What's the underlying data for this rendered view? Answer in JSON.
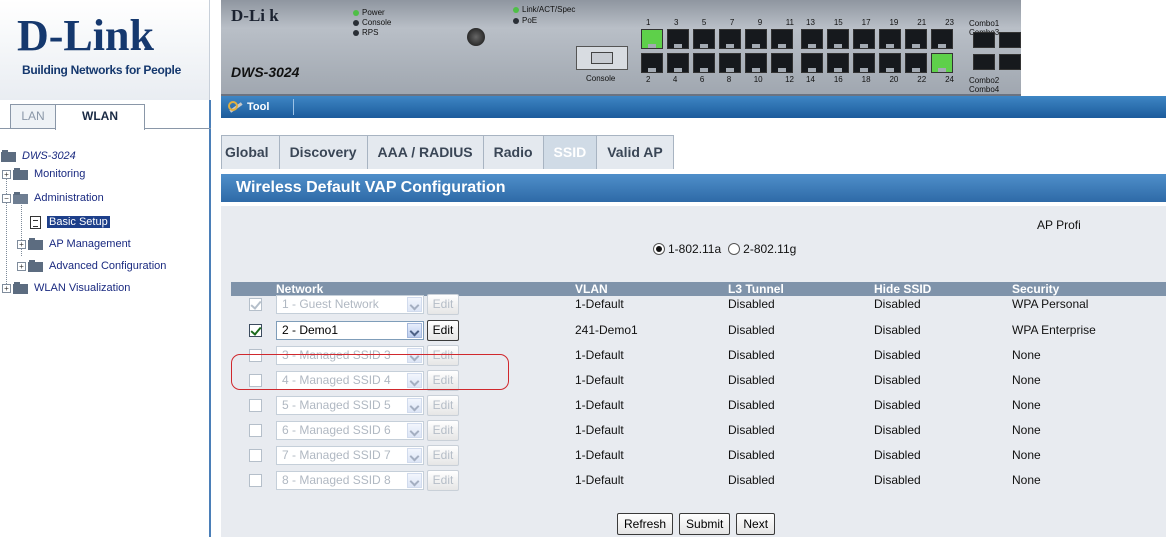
{
  "logo": {
    "brand": "D-Link",
    "tagline": "Building Networks for People"
  },
  "device": {
    "brand": "D-Li k",
    "model": "DWS-3024",
    "leds": [
      "Power",
      "Console",
      "RPS",
      "Link/ACT/Spec",
      "PoE"
    ],
    "console_label": "Console",
    "port_numbers_top": [
      "1",
      "3",
      "5",
      "7",
      "9",
      "11",
      "13",
      "15",
      "17",
      "19",
      "21",
      "23"
    ],
    "port_numbers_bottom": [
      "2",
      "4",
      "6",
      "8",
      "10",
      "12",
      "14",
      "16",
      "18",
      "20",
      "22",
      "24"
    ],
    "combo_top": "Combo1 Combo3",
    "combo_bottom": "Combo2 Combo4"
  },
  "toolbar": {
    "tool_label": "Tool"
  },
  "sidebar": {
    "tabs": [
      {
        "label": "LAN"
      },
      {
        "label": "WLAN"
      }
    ],
    "tree": [
      {
        "label": "DWS-3024"
      },
      {
        "label": "Monitoring"
      },
      {
        "label": "Administration"
      },
      {
        "label": "Basic Setup"
      },
      {
        "label": "AP Management"
      },
      {
        "label": "Advanced Configuration"
      },
      {
        "label": "WLAN Visualization"
      }
    ]
  },
  "main": {
    "tabs": [
      {
        "label": "Global"
      },
      {
        "label": "Discovery"
      },
      {
        "label": "AAA / RADIUS"
      },
      {
        "label": "Radio"
      },
      {
        "label": "SSID"
      },
      {
        "label": "Valid AP"
      }
    ],
    "active_tab": "SSID",
    "panel_title": "Wireless Default VAP Configuration",
    "ap_profile_label": "AP Profi",
    "radio_options": [
      {
        "label": "1-802.11a",
        "selected": true
      },
      {
        "label": "2-802.11g",
        "selected": false
      }
    ],
    "table": {
      "headers": {
        "network": "Network",
        "vlan": "VLAN",
        "l3_tunnel": "L3 Tunnel",
        "hide_ssid": "Hide SSID",
        "security": "Security"
      },
      "rows": [
        {
          "checked": true,
          "enabled": false,
          "network": "1 - Guest Network",
          "edit": "Edit",
          "vlan": "1-Default",
          "l3_tunnel": "Disabled",
          "hide_ssid": "Disabled",
          "security": "WPA Personal"
        },
        {
          "checked": true,
          "enabled": true,
          "network": "2 - Demo1",
          "edit": "Edit",
          "vlan": "241-Demo1",
          "l3_tunnel": "Disabled",
          "hide_ssid": "Disabled",
          "security": "WPA Enterprise"
        },
        {
          "checked": false,
          "enabled": false,
          "network": "3 - Managed SSID 3",
          "edit": "Edit",
          "vlan": "1-Default",
          "l3_tunnel": "Disabled",
          "hide_ssid": "Disabled",
          "security": "None"
        },
        {
          "checked": false,
          "enabled": false,
          "network": "4 - Managed SSID 4",
          "edit": "Edit",
          "vlan": "1-Default",
          "l3_tunnel": "Disabled",
          "hide_ssid": "Disabled",
          "security": "None"
        },
        {
          "checked": false,
          "enabled": false,
          "network": "5 - Managed SSID 5",
          "edit": "Edit",
          "vlan": "1-Default",
          "l3_tunnel": "Disabled",
          "hide_ssid": "Disabled",
          "security": "None"
        },
        {
          "checked": false,
          "enabled": false,
          "network": "6 - Managed SSID 6",
          "edit": "Edit",
          "vlan": "1-Default",
          "l3_tunnel": "Disabled",
          "hide_ssid": "Disabled",
          "security": "None"
        },
        {
          "checked": false,
          "enabled": false,
          "network": "7 - Managed SSID 7",
          "edit": "Edit",
          "vlan": "1-Default",
          "l3_tunnel": "Disabled",
          "hide_ssid": "Disabled",
          "security": "None"
        },
        {
          "checked": false,
          "enabled": false,
          "network": "8 - Managed SSID 8",
          "edit": "Edit",
          "vlan": "1-Default",
          "l3_tunnel": "Disabled",
          "hide_ssid": "Disabled",
          "security": "None"
        }
      ]
    },
    "buttons": {
      "refresh": "Refresh",
      "submit": "Submit",
      "next": "Next"
    }
  },
  "colors": {
    "brand": "#15386e",
    "header_blue": "#2e6aa7",
    "highlight": "#d0282d",
    "port_lit": "#5ed04a"
  }
}
